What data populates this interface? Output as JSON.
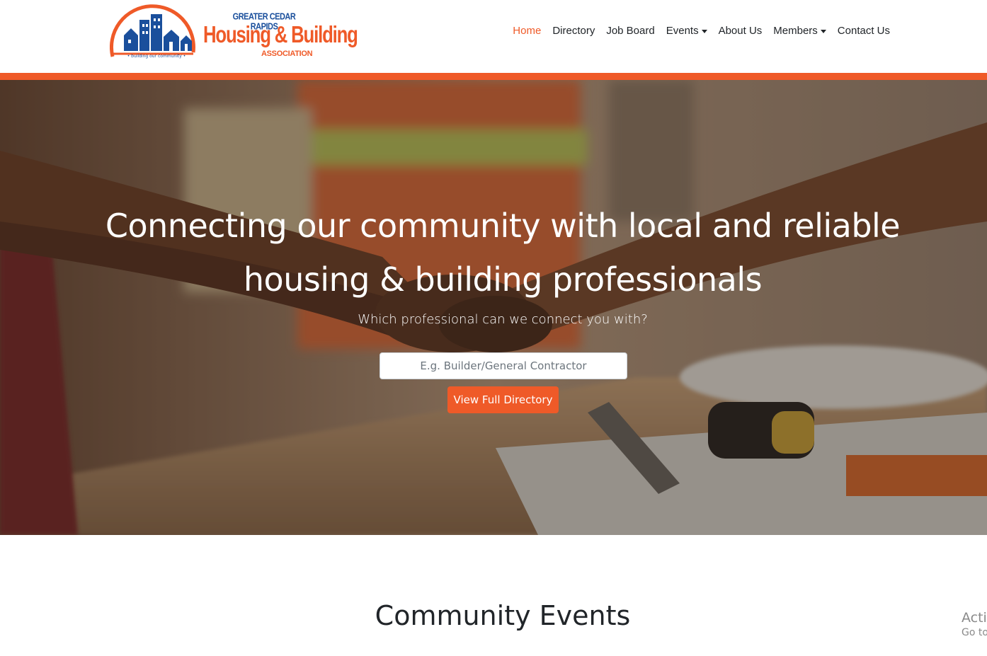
{
  "brand": {
    "logo_top": "GREATER CEDAR RAPIDS",
    "logo_main": "Housing & Building",
    "logo_sub": "ASSOCIATION",
    "tagline": "• building our community •",
    "colors": {
      "orange": "#ef5a28",
      "blue": "#1a4f9c"
    }
  },
  "nav": {
    "items": [
      {
        "label": "Home",
        "active": true
      },
      {
        "label": "Directory"
      },
      {
        "label": "Job Board"
      },
      {
        "label": "Events",
        "dropdown": true
      },
      {
        "label": "About Us"
      },
      {
        "label": "Members",
        "dropdown": true
      },
      {
        "label": "Contact Us"
      }
    ]
  },
  "hero": {
    "title_line1": "Connecting our community with local and reliable",
    "title_line2": "housing & building professionals",
    "subtitle": "Which professional can we connect you with?",
    "search_placeholder": "E.g. Builder/General Contractor",
    "button_label": "View Full Directory",
    "background": "handshake-photo"
  },
  "events": {
    "title": "Community Events"
  },
  "watermark": {
    "line1": "Activ",
    "line2": "Go to"
  }
}
